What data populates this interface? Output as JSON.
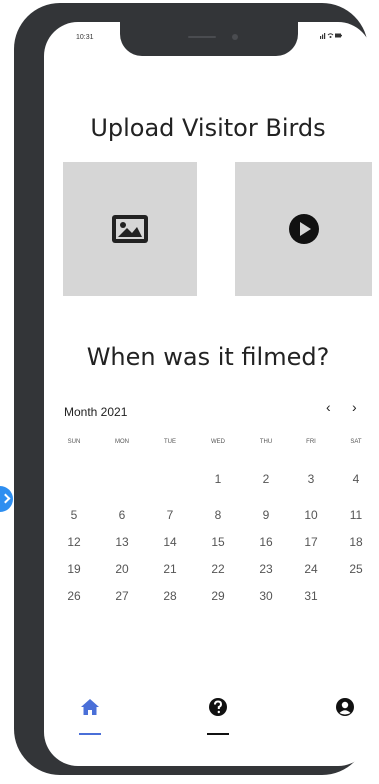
{
  "status": {
    "time": "10:31",
    "icons": "signal-icon wifi-icon battery-icon"
  },
  "upload": {
    "title": "Upload Visitor Birds",
    "photo_icon": "image-icon",
    "video_icon": "play-circle-icon"
  },
  "calendar": {
    "title": "When was it filmed?",
    "month_label": "Month 2021",
    "prev": "‹",
    "next": "›",
    "weekdays": [
      "SUN",
      "MON",
      "TUE",
      "WED",
      "THU",
      "FRI",
      "SAT"
    ],
    "weeks": [
      [
        "",
        "",
        "",
        "1",
        "2",
        "3",
        "4"
      ],
      [
        "5",
        "6",
        "7",
        "8",
        "9",
        "10",
        "11"
      ],
      [
        "12",
        "13",
        "14",
        "15",
        "16",
        "17",
        "18"
      ],
      [
        "19",
        "20",
        "21",
        "22",
        "23",
        "24",
        "25"
      ],
      [
        "26",
        "27",
        "28",
        "29",
        "30",
        "31",
        ""
      ]
    ]
  },
  "bottom_nav": [
    {
      "icon": "home-icon",
      "active": true
    },
    {
      "icon": "help-icon",
      "active": false
    },
    {
      "icon": "user-icon",
      "active": false
    }
  ],
  "colors": {
    "active_tab": "#4a6fd8",
    "frame": "#333538",
    "tile": "#d6d6d6",
    "marker": "#2e8ef0"
  }
}
